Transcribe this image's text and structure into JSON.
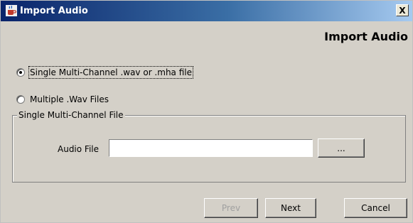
{
  "window": {
    "title": "Import Audio",
    "close_label": "X",
    "title_icon": "java-coffee-cup-icon"
  },
  "header": {
    "title": "Import Audio"
  },
  "options": {
    "single": {
      "label": "Single Multi-Channel .wav or .mha file",
      "selected": true
    },
    "multiple": {
      "label": "Multiple .Wav Files",
      "selected": false
    }
  },
  "group": {
    "legend": "Single Multi-Channel File",
    "audio_file_label": "Audio File",
    "audio_file_value": "",
    "browse_label": "..."
  },
  "buttons": {
    "prev": "Prev",
    "next": "Next",
    "cancel": "Cancel"
  }
}
